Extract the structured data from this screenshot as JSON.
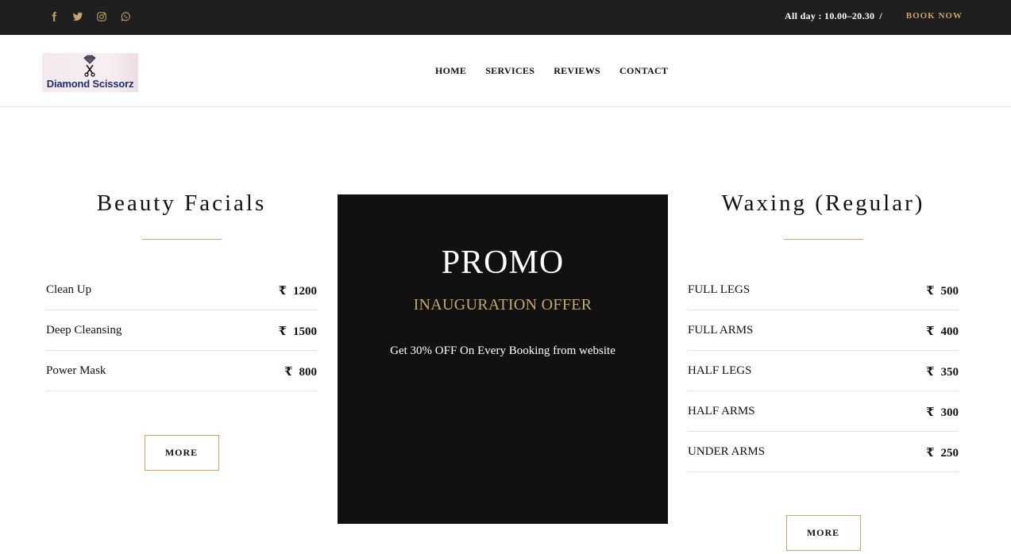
{
  "topbar": {
    "social": [
      {
        "name": "facebook-icon"
      },
      {
        "name": "twitter-icon"
      },
      {
        "name": "instagram-icon"
      },
      {
        "name": "whatsapp-icon"
      }
    ],
    "hours": "All day : 10.00–20.30",
    "separator": "/",
    "book_now": "BOOK NOW"
  },
  "header": {
    "logo_text": "Diamond Scissorz",
    "nav": [
      "HOME",
      "SERVICES",
      "REVIEWS",
      "CONTACT"
    ]
  },
  "facials": {
    "title": "Beauty Facials",
    "items": [
      {
        "name": "Clean Up",
        "price": "1200"
      },
      {
        "name": "Deep Cleansing",
        "price": "1500"
      },
      {
        "name": "Power Mask",
        "price": "800"
      }
    ],
    "more_label": "MORE"
  },
  "promo": {
    "title": "PROMO",
    "subtitle": "INAUGURATION OFFER",
    "text": "Get 30% OFF On Every Booking from website"
  },
  "waxing": {
    "title": "Waxing (Regular)",
    "items": [
      {
        "name": "FULL LEGS",
        "price": "500"
      },
      {
        "name": "FULL ARMS",
        "price": "400"
      },
      {
        "name": "HALF LEGS",
        "price": "350"
      },
      {
        "name": "HALF ARMS",
        "price": "300"
      },
      {
        "name": "UNDER ARMS",
        "price": "250"
      }
    ],
    "more_label": "MORE"
  },
  "currency_symbol": "₹",
  "colors": {
    "accent": "#c9a56b",
    "topbar": "#1f1f1f",
    "promo_bg": "#111111",
    "logo_text": "#1f2f6b"
  }
}
